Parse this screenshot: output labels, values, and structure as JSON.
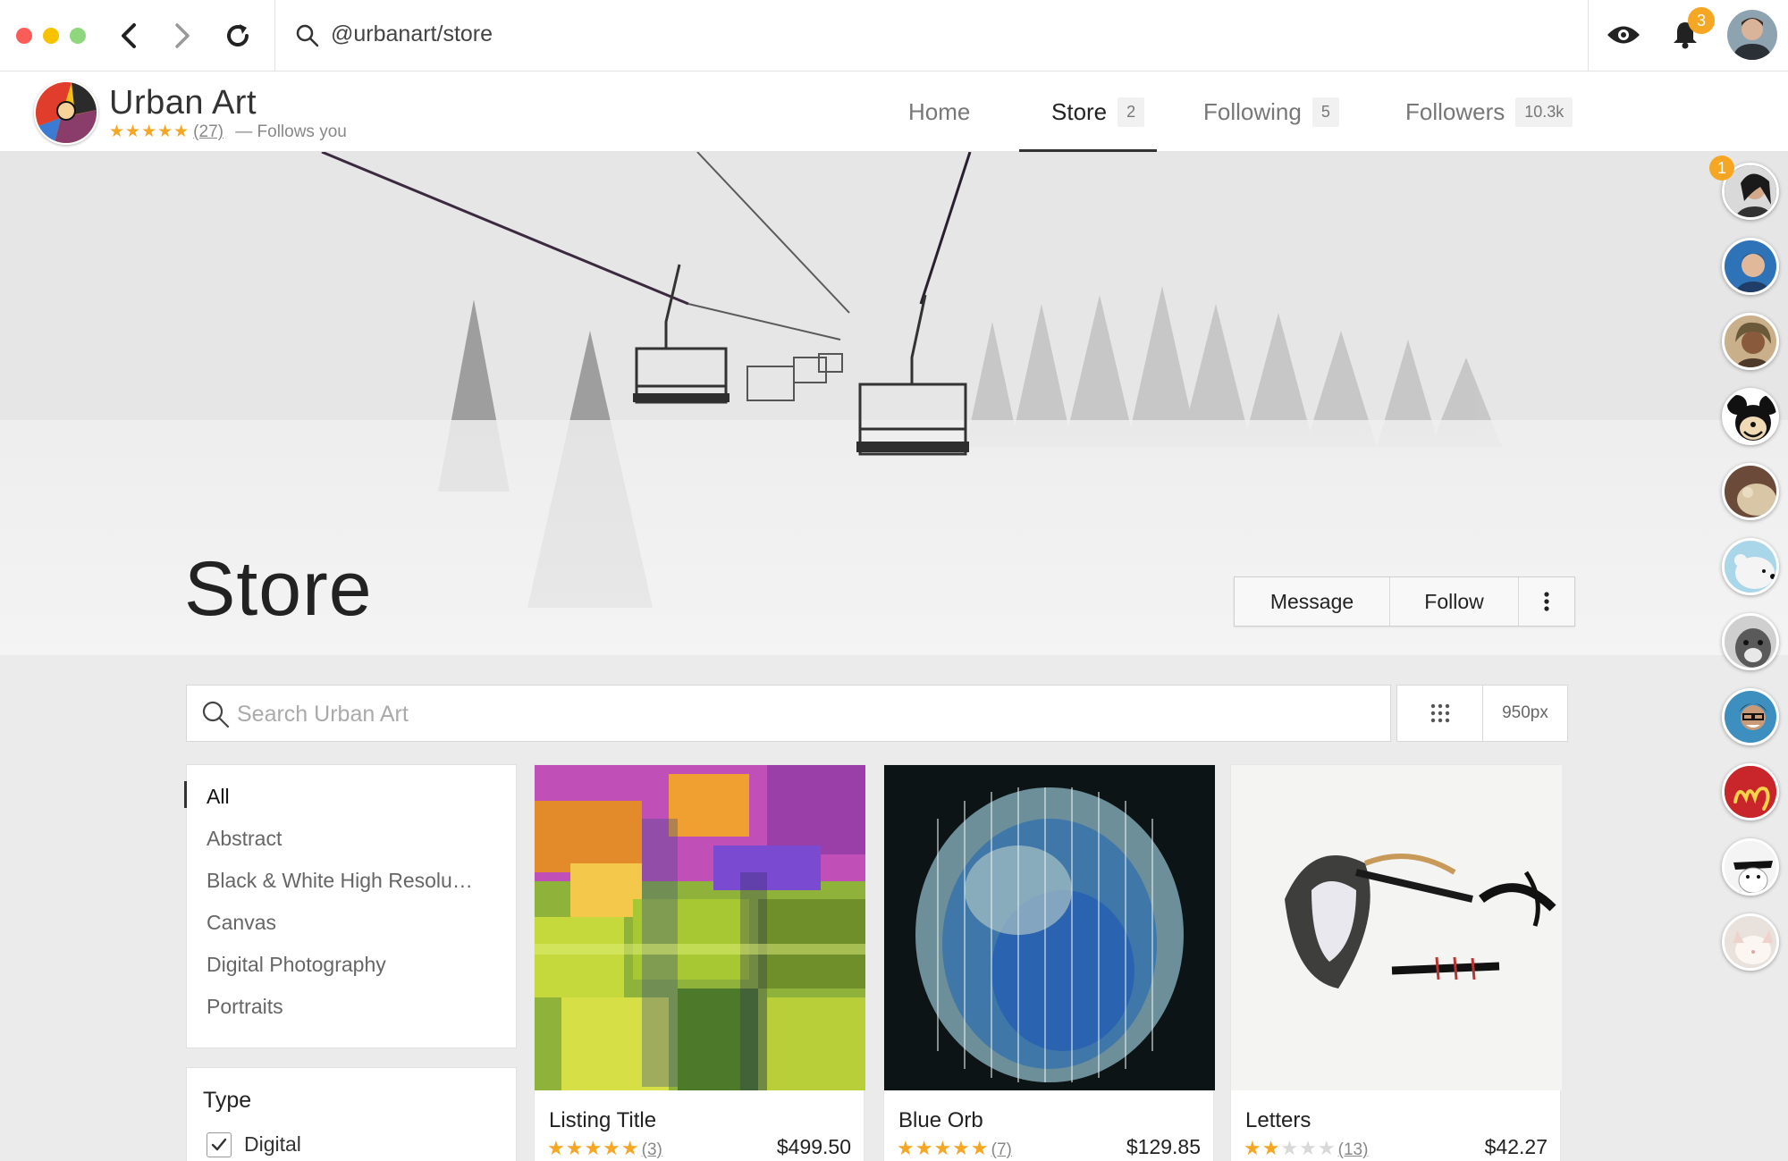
{
  "browser": {
    "url": "@urbanart/store",
    "notification_count": "3"
  },
  "profile": {
    "name": "Urban Art",
    "stars": "★★★★★",
    "rating_count": "(27)",
    "relation": "— Follows you"
  },
  "tabs": [
    {
      "label": "Home",
      "count": ""
    },
    {
      "label": "Store",
      "count": "2"
    },
    {
      "label": "Following",
      "count": "5"
    },
    {
      "label": "Followers",
      "count": "10.3k"
    }
  ],
  "hero": {
    "title": "Store",
    "message_label": "Message",
    "follow_label": "Follow"
  },
  "search": {
    "placeholder": "Search Urban Art",
    "size_label": "950px"
  },
  "filters": {
    "categories": [
      "All",
      "Abstract",
      "Black & White High Resolu…",
      "Canvas",
      "Digital Photography",
      "Portraits"
    ],
    "active": "All",
    "type_title": "Type",
    "type_option": "Digital",
    "type_checked": true
  },
  "listings": [
    {
      "title": "Listing Title",
      "rating": 5,
      "rating_count": "(3)",
      "price": "$499.50"
    },
    {
      "title": "Blue Orb",
      "rating": 5,
      "rating_count": "(7)",
      "price": "$129.85"
    },
    {
      "title": "Letters",
      "rating": 2,
      "rating_count": "(13)",
      "price": "$42.27"
    }
  ],
  "rail": {
    "first_badge": "1",
    "avatar_count": 11
  },
  "colors": {
    "accent": "#f5a623",
    "close": "#fc5c57",
    "minimize": "#f7c300",
    "maximize": "#8fd77d"
  }
}
